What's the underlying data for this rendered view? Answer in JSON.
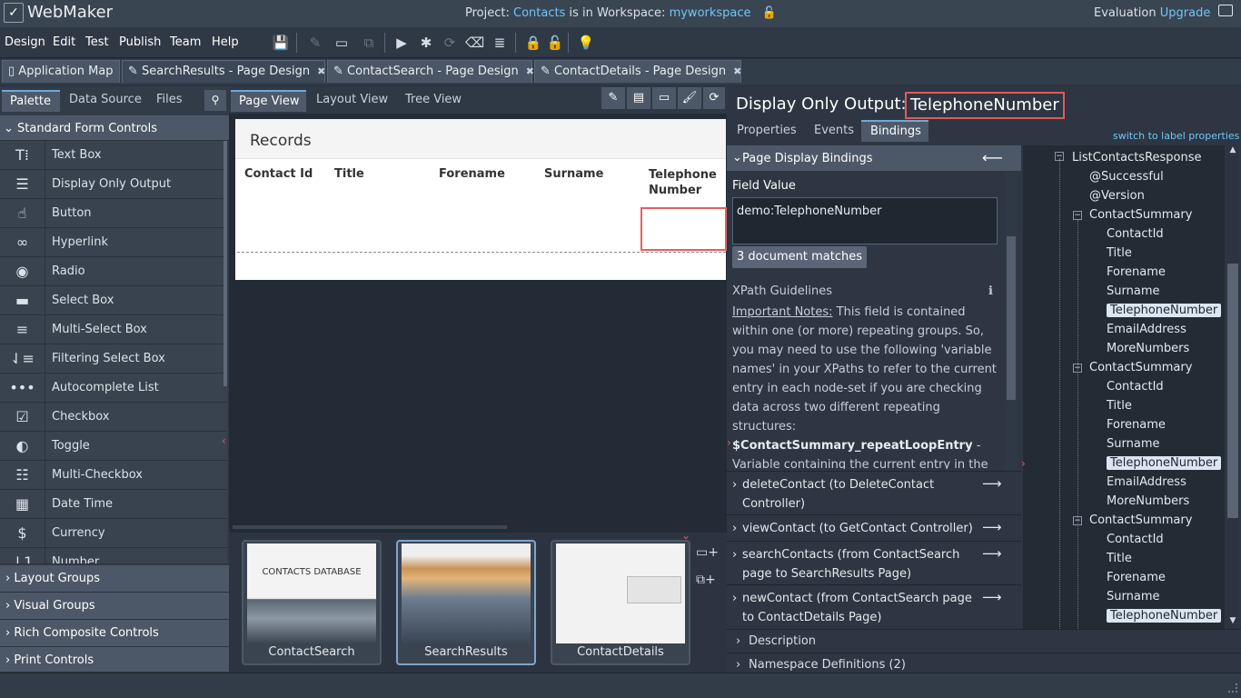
{
  "title_bar": {
    "app_name": "WebMaker",
    "project_prefix": "Project:",
    "project_name": "Contacts",
    "workspace_prefix": "is in Workspace:",
    "workspace_name": "myworkspace",
    "evaluation_label": "Evaluation",
    "upgrade_link": "Upgrade"
  },
  "menu": [
    "Design",
    "Edit",
    "Test",
    "Publish",
    "Team",
    "Help"
  ],
  "toolbar_icons": [
    "save-icon",
    "edit-icon",
    "monitor-icon",
    "hierarchy-icon",
    "play-icon",
    "bug-icon",
    "refresh-icon",
    "eraser-icon",
    "server-icon",
    "lock-icon",
    "unlock-icon",
    "lightbulb-icon"
  ],
  "tabs": [
    {
      "label": "Application Map",
      "closable": false
    },
    {
      "label": "SearchResults - Page Design",
      "closable": true,
      "active": true
    },
    {
      "label": "ContactSearch - Page Design",
      "closable": true
    },
    {
      "label": "ContactDetails - Page Design",
      "closable": true
    }
  ],
  "left_panel": {
    "tabs": [
      "Palette",
      "Data Source",
      "Files"
    ],
    "category_open": "Standard Form Controls",
    "items": [
      "Text Box",
      "Display Only Output",
      "Button",
      "Hyperlink",
      "Radio",
      "Select Box",
      "Multi-Select Box",
      "Filtering Select Box",
      "Autocomplete List",
      "Checkbox",
      "Toggle",
      "Multi-Checkbox",
      "Date Time",
      "Currency",
      "Number"
    ],
    "categories_closed": [
      "Layout Groups",
      "Visual Groups",
      "Rich Composite Controls",
      "Print Controls"
    ]
  },
  "center": {
    "view_tabs": [
      "Page View",
      "Layout View",
      "Tree View"
    ],
    "records_title": "Records",
    "columns": [
      "Contact Id",
      "Title",
      "Forename",
      "Surname",
      "Telephone Number"
    ],
    "thumbnails": [
      "ContactSearch",
      "SearchResults",
      "ContactDetails"
    ],
    "thumb_contacts_db": "CONTACTS DATABASE"
  },
  "right_panel": {
    "header_label": "Display Only Output:",
    "header_value": "TelephoneNumber",
    "tabs": [
      "Properties",
      "Events",
      "Bindings"
    ],
    "switch_link": "switch to label properties",
    "bindings_section": "Page Display Bindings",
    "field_value_label": "Field Value",
    "field_value": "demo:TelephoneNumber",
    "matches": "3 document matches",
    "xpath_title": "XPath Guidelines",
    "important_notes": "Important Notes:",
    "notes_text": "This field is contained within one (or more) repeating groups. So, you may need to use the following 'variable names' in your XPaths to refer to the current entry in each node-set if you are checking data across two different repeating structures:",
    "variable_name": "$ContactSummary_repeatLoopEntry",
    "variable_desc": "- Variable containing the current entry in the",
    "events": [
      "deleteContact (to DeleteContact Controller)",
      "viewContact (to GetContact Controller)",
      "searchContacts (from ContactSearch page to SearchResults Page)",
      "newContact (from ContactSearch page to ContactDetails Page)"
    ],
    "description": "Description",
    "namespaces": "Namespace Definitions (2)"
  },
  "tree": {
    "root": "ListContactsResponse",
    "attrs": [
      "@Successful",
      "@Version"
    ],
    "group": "ContactSummary",
    "fields": [
      "ContactId",
      "Title",
      "Forename",
      "Surname",
      "TelephoneNumber",
      "EmailAddress",
      "MoreNumbers"
    ]
  }
}
